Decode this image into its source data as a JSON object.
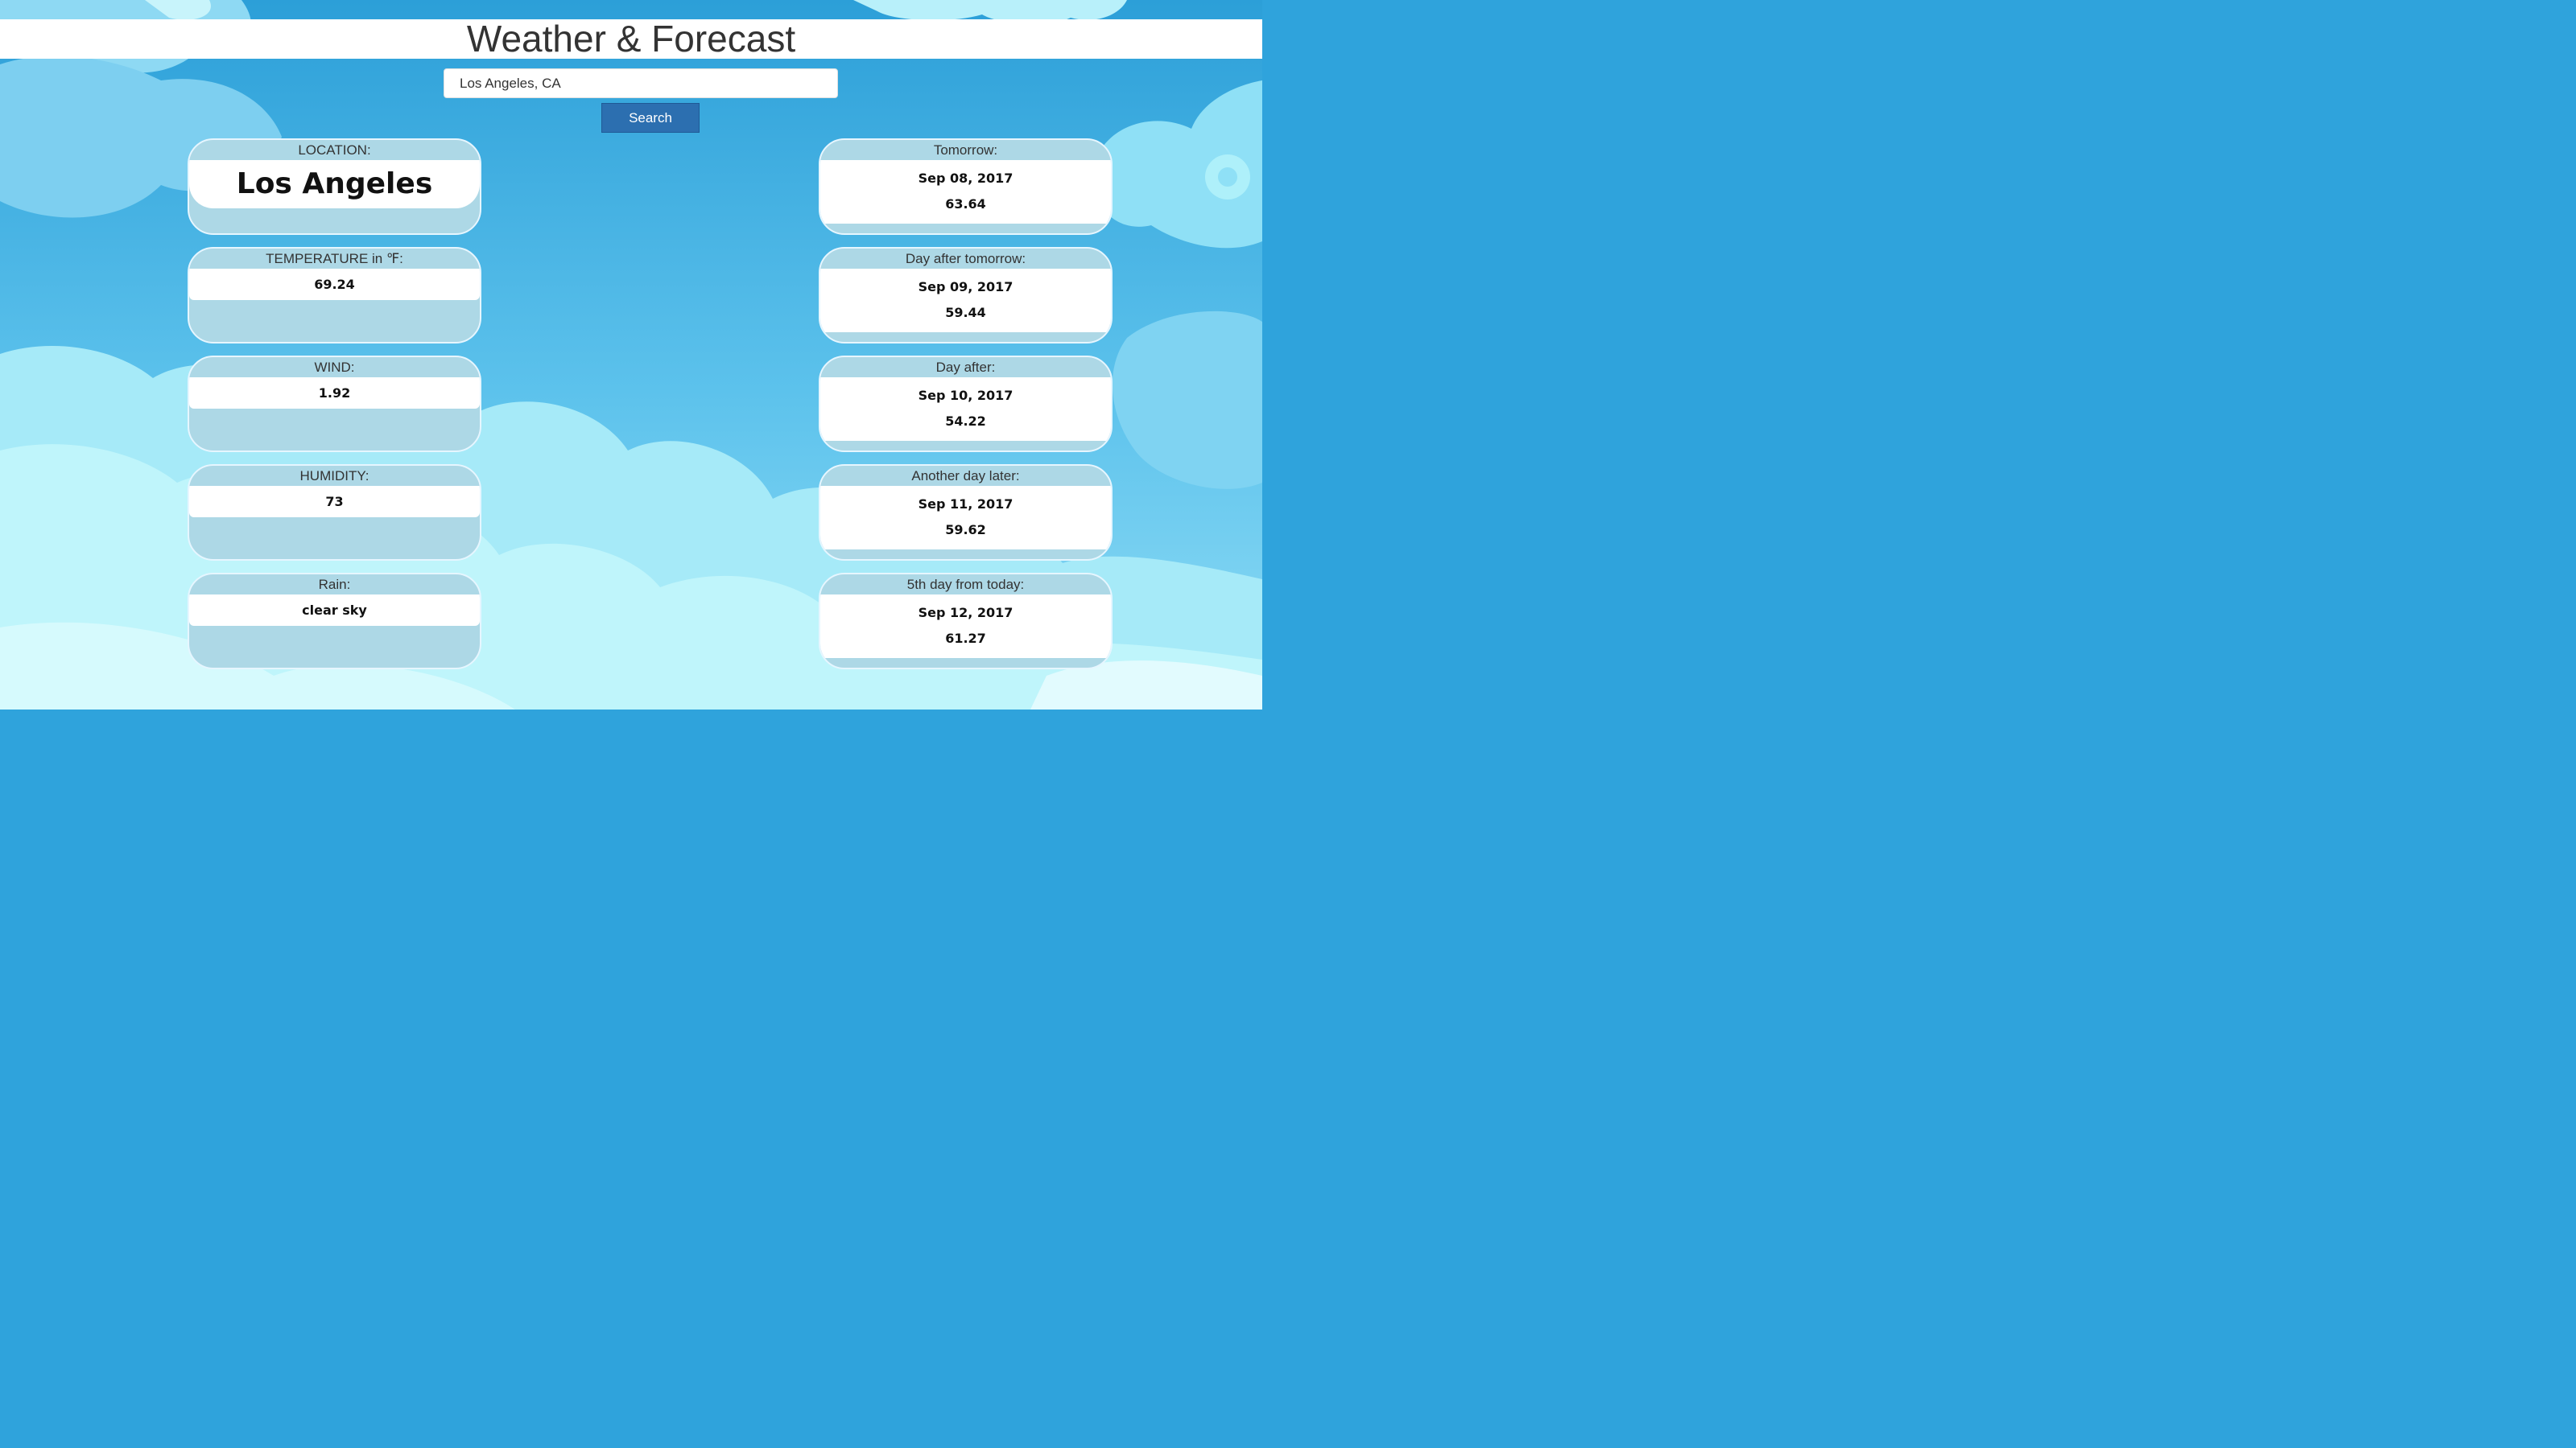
{
  "header": {
    "title": "Weather & Forecast"
  },
  "search": {
    "value": "Los Angeles, CA",
    "button_label": "Search"
  },
  "current": [
    {
      "label": "LOCATION:",
      "value": "Los Angeles"
    },
    {
      "label": "TEMPERATURE in ℉:",
      "value": "69.24"
    },
    {
      "label": "WIND:",
      "value": "1.92"
    },
    {
      "label": "HUMIDITY:",
      "value": "73"
    },
    {
      "label": "Rain:",
      "value": "clear sky"
    }
  ],
  "forecast": [
    {
      "label": "Tomorrow:",
      "date": "Sep 08, 2017",
      "temp": "63.64"
    },
    {
      "label": "Day after tomorrow:",
      "date": "Sep 09, 2017",
      "temp": "59.44"
    },
    {
      "label": "Day after:",
      "date": "Sep 10, 2017",
      "temp": "54.22"
    },
    {
      "label": "Another day later:",
      "date": "Sep 11, 2017",
      "temp": "59.62"
    },
    {
      "label": "5th day from today:",
      "date": "Sep 12, 2017",
      "temp": "61.27"
    }
  ],
  "colors": {
    "sky": "#2fa3dc",
    "card_bg": "#add8e6",
    "button": "#2c6fb0"
  }
}
